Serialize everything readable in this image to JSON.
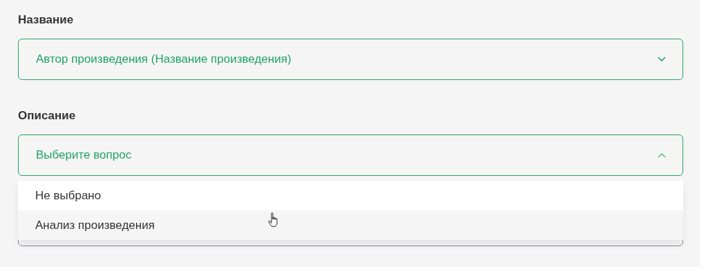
{
  "fields": [
    {
      "label": "Название",
      "value": "Автор произведения (Название произведения)",
      "expanded": false
    },
    {
      "label": "Описание",
      "value": "Выберите вопрос",
      "expanded": true,
      "options": [
        {
          "text": "Не выбрано",
          "hovered": false
        },
        {
          "text": "Анализ произведения",
          "hovered": true
        }
      ]
    }
  ]
}
